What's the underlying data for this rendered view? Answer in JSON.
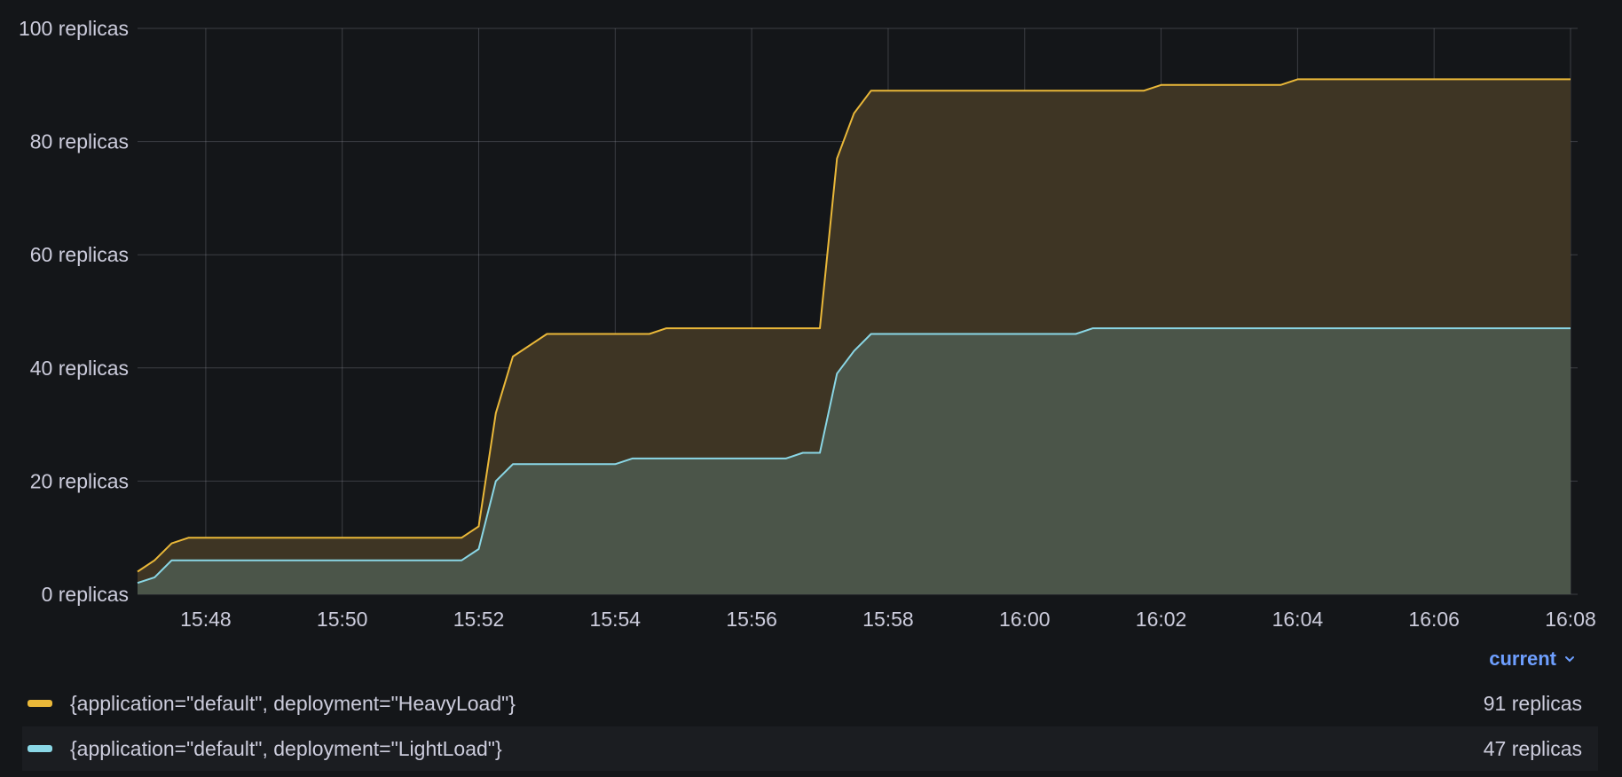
{
  "chart_data": {
    "type": "area",
    "stacked": true,
    "yunit": "replicas",
    "ylim": [
      0,
      100
    ],
    "yticks": [
      0,
      20,
      40,
      60,
      80,
      100
    ],
    "ytick_labels": [
      "0 replicas",
      "20 replicas",
      "40 replicas",
      "60 replicas",
      "80 replicas",
      "100 replicas"
    ],
    "xlim": [
      "15:47:00",
      "16:08:00"
    ],
    "xticks": [
      "15:48",
      "15:50",
      "15:52",
      "15:54",
      "15:56",
      "15:58",
      "16:00",
      "16:02",
      "16:04",
      "16:06",
      "16:08"
    ],
    "grid": true,
    "series": [
      {
        "name": "{application=\"default\", deployment=\"HeavyLoad\"}",
        "color": "#eab839",
        "fill": "#3e3524",
        "x": [
          "15:47:00",
          "15:47:15",
          "15:47:30",
          "15:47:45",
          "15:51:45",
          "15:52:00",
          "15:52:15",
          "15:52:30",
          "15:53:00",
          "15:54:30",
          "15:54:45",
          "15:57:00",
          "15:57:15",
          "15:57:30",
          "15:57:45",
          "16:01:45",
          "16:02:00",
          "16:03:45",
          "16:04:00",
          "16:08:00"
        ],
        "y": [
          4,
          6,
          9,
          10,
          10,
          12,
          32,
          42,
          46,
          46,
          47,
          47,
          77,
          85,
          89,
          89,
          90,
          90,
          91,
          91
        ]
      },
      {
        "name": "{application=\"default\", deployment=\"LightLoad\"}",
        "color": "#8ad7e6",
        "fill": "#4b5549",
        "x": [
          "15:47:00",
          "15:47:15",
          "15:47:30",
          "15:51:45",
          "15:52:00",
          "15:52:15",
          "15:52:30",
          "15:54:00",
          "15:54:15",
          "15:56:30",
          "15:56:45",
          "15:57:00",
          "15:57:15",
          "15:57:30",
          "15:57:45",
          "16:00:45",
          "16:01:00",
          "16:08:00"
        ],
        "y": [
          2,
          3,
          6,
          6,
          8,
          20,
          23,
          23,
          24,
          24,
          25,
          25,
          39,
          43,
          46,
          46,
          47,
          47
        ]
      }
    ]
  },
  "legend": {
    "header": "current",
    "rows": [
      {
        "label": "{application=\"default\", deployment=\"HeavyLoad\"}",
        "value": "91 replicas",
        "color": "#eab839"
      },
      {
        "label": "{application=\"default\", deployment=\"LightLoad\"}",
        "value": "47 replicas",
        "color": "#8ad7e6"
      }
    ]
  }
}
